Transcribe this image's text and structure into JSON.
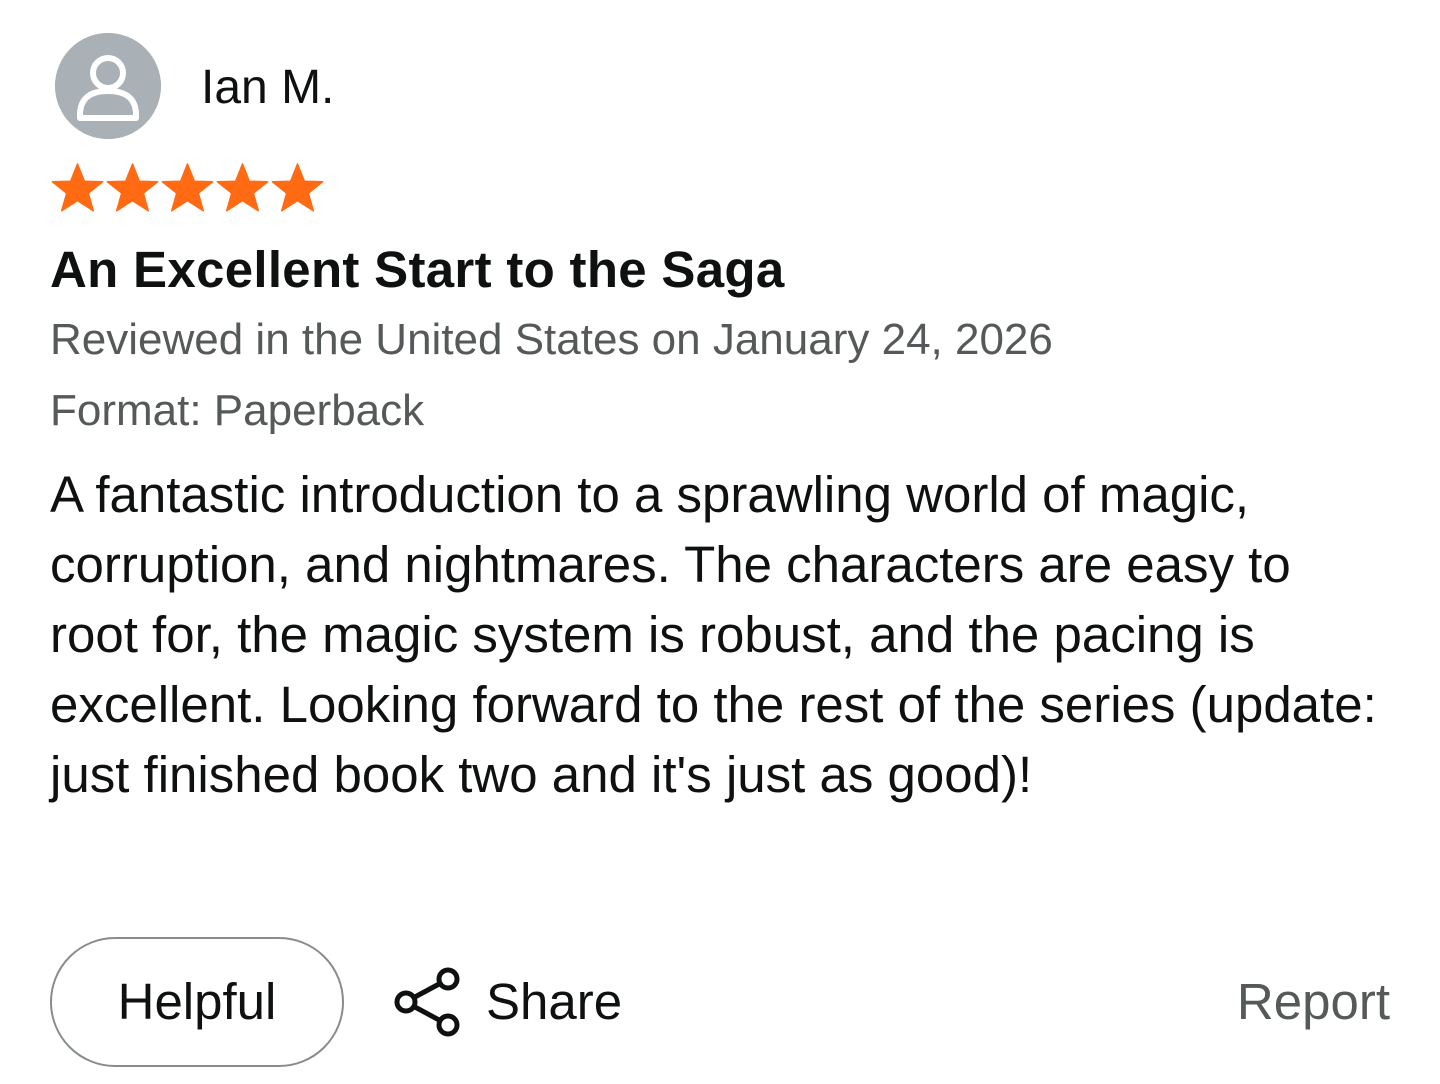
{
  "reviewer": {
    "name": "Ian M.",
    "avatar_icon": "default-user-avatar"
  },
  "rating": {
    "value": 5,
    "max": 5,
    "star_color": "#ff6a13"
  },
  "review": {
    "title": "An Excellent Start to the Saga",
    "meta": "Reviewed in the United States on January 24, 2026",
    "format": "Format: Paperback",
    "body": "A fantastic introduction to a sprawling world of magic, corruption, and nightmares. The characters are easy to root for, the magic system is robust, and the pacing is excellent. Looking forward to the rest of the series (update: just finished book two and it's just as good)!"
  },
  "actions": {
    "helpful_label": "Helpful",
    "share_label": "Share",
    "share_icon": "share-icon",
    "report_label": "Report"
  }
}
